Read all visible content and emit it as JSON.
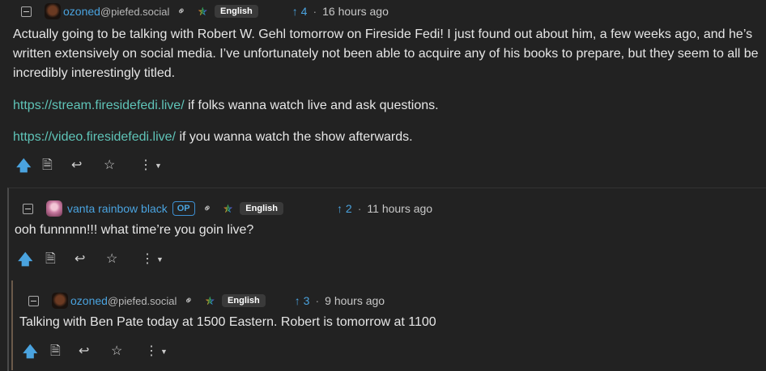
{
  "comments": [
    {
      "username": "ozoned",
      "instance": "@piefed.social",
      "language": "English",
      "votes": "4",
      "time": "16 hours ago",
      "paragraphs": [
        {
          "link": "",
          "text": "Actually going to be talking with Robert W. Gehl tomorrow on Fireside Fedi! I just found out about him, a few weeks ago, and he’s written extensively on social media. I’ve unfortunately not been able to acquire any of his books to prepare, but they seem to all be incredibly interestingly titled."
        },
        {
          "link": "https://stream.firesidefedi.live/",
          "text": " if folks wanna watch live and ask questions."
        },
        {
          "link": "https://video.firesidefedi.live/",
          "text": " if you wanna watch the show afterwards."
        }
      ]
    },
    {
      "username": "vanta rainbow black",
      "badge": "OP",
      "language": "English",
      "votes": "2",
      "time": "11 hours ago",
      "text": "ooh funnnnn!!! what time’re you goin live?"
    },
    {
      "username": "ozoned",
      "instance": "@piefed.social",
      "language": "English",
      "votes": "3",
      "time": "9 hours ago",
      "text": "Talking with Ben Pate today at 1500 Eastern. Robert is tomorrow at 1100"
    }
  ],
  "icons": {
    "collapse": "minus-square-icon",
    "link": "link-icon",
    "language": "rainbow-star-icon",
    "upvote": "arrow-up-icon",
    "source": "document-icon",
    "reply": "reply-icon",
    "save": "star-icon",
    "more": "more-vertical-icon"
  },
  "colors": {
    "background": "#222222",
    "username": "#4aa3df",
    "link": "#5fc4b8",
    "vote": "#4aa3df"
  }
}
